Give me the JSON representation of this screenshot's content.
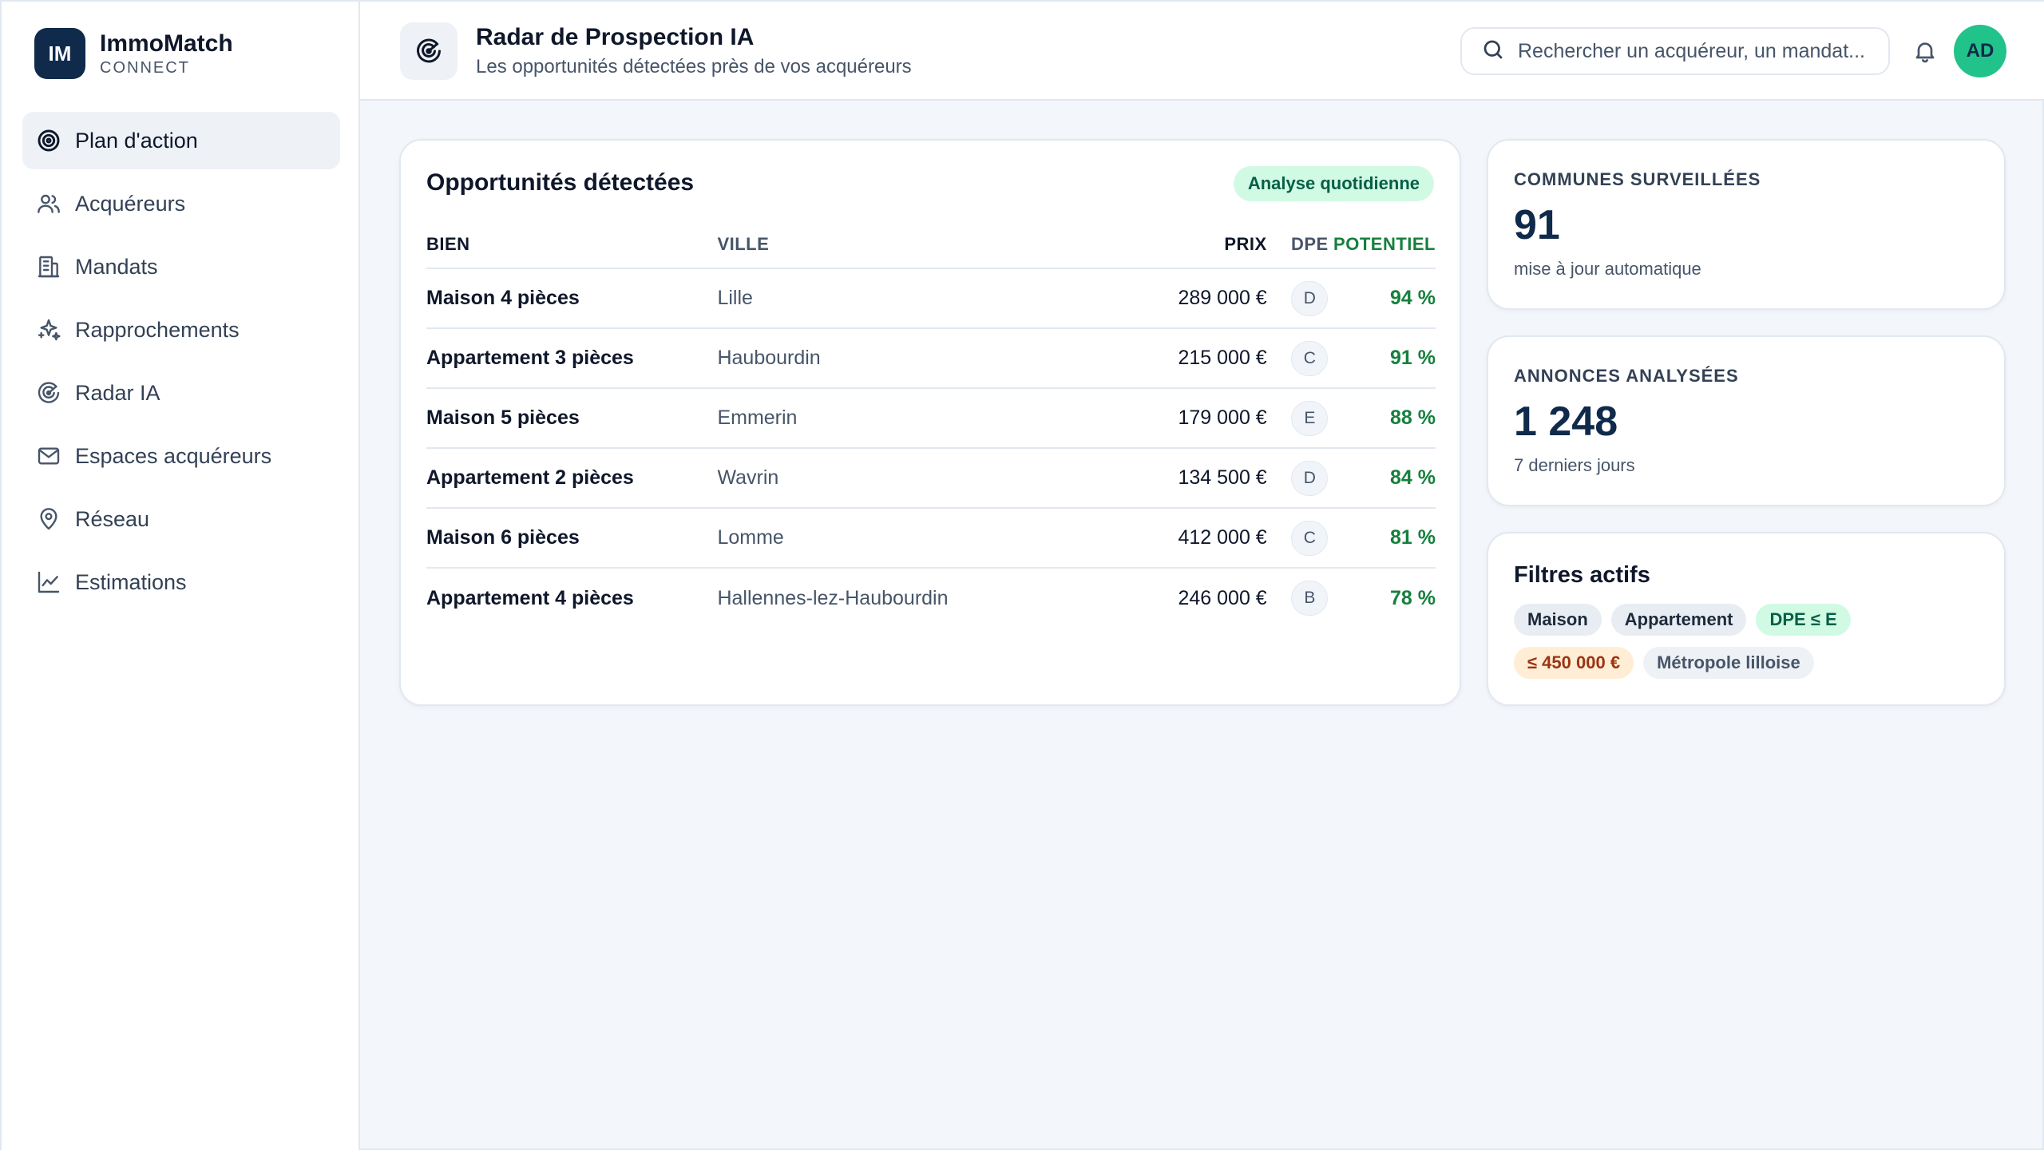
{
  "brand": {
    "initials": "IM",
    "name": "ImmoMatch",
    "sub": "CONNECT"
  },
  "nav": [
    {
      "label": "Plan d'action",
      "icon": "target-icon",
      "active": true
    },
    {
      "label": "Acquéreurs",
      "icon": "users-icon"
    },
    {
      "label": "Mandats",
      "icon": "building-icon"
    },
    {
      "label": "Rapprochements",
      "icon": "sparkles-icon"
    },
    {
      "label": "Radar IA",
      "icon": "radar-icon"
    },
    {
      "label": "Espaces acquéreurs",
      "icon": "mail-icon"
    },
    {
      "label": "Réseau",
      "icon": "map-pin-icon"
    },
    {
      "label": "Estimations",
      "icon": "chart-line-icon"
    }
  ],
  "header": {
    "title": "Radar de Prospection IA",
    "subtitle": "Les opportunités détectées près de vos acquéreurs",
    "search_placeholder": "Rechercher un acquéreur, un mandat...",
    "avatar": "AD"
  },
  "opportunities": {
    "title": "Opportunités détectées",
    "badge": "Analyse quotidienne",
    "columns": {
      "bien": "BIEN",
      "ville": "VILLE",
      "prix": "PRIX",
      "dpe": "DPE",
      "potentiel": "POTENTIEL"
    },
    "rows": [
      {
        "bien": "Maison 4 pièces",
        "ville": "Lille",
        "prix": "289 000 €",
        "dpe": "D",
        "potentiel": "94 %"
      },
      {
        "bien": "Appartement 3 pièces",
        "ville": "Haubourdin",
        "prix": "215 000 €",
        "dpe": "C",
        "potentiel": "91 %"
      },
      {
        "bien": "Maison 5 pièces",
        "ville": "Emmerin",
        "prix": "179 000 €",
        "dpe": "E",
        "potentiel": "88 %"
      },
      {
        "bien": "Appartement 2 pièces",
        "ville": "Wavrin",
        "prix": "134 500 €",
        "dpe": "D",
        "potentiel": "84 %"
      },
      {
        "bien": "Maison 6 pièces",
        "ville": "Lomme",
        "prix": "412 000 €",
        "dpe": "C",
        "potentiel": "81 %"
      },
      {
        "bien": "Appartement 4 pièces",
        "ville": "Hallennes-lez-Haubourdin",
        "prix": "246 000 €",
        "dpe": "B",
        "potentiel": "78 %"
      }
    ]
  },
  "stats": [
    {
      "label": "COMMUNES SURVEILLÉES",
      "value": "91",
      "note": "mise à jour automatique"
    },
    {
      "label": "ANNONCES ANALYSÉES",
      "value": "1 248",
      "note": "7 derniers jours"
    }
  ],
  "filters": {
    "title": "Filtres actifs",
    "chips": [
      {
        "label": "Maison",
        "style": "default"
      },
      {
        "label": "Appartement",
        "style": "default"
      },
      {
        "label": "DPE ≤ E",
        "style": "green"
      },
      {
        "label": "≤ 450 000 €",
        "style": "orange"
      },
      {
        "label": "Métropole lilloise",
        "style": "gray"
      }
    ]
  }
}
